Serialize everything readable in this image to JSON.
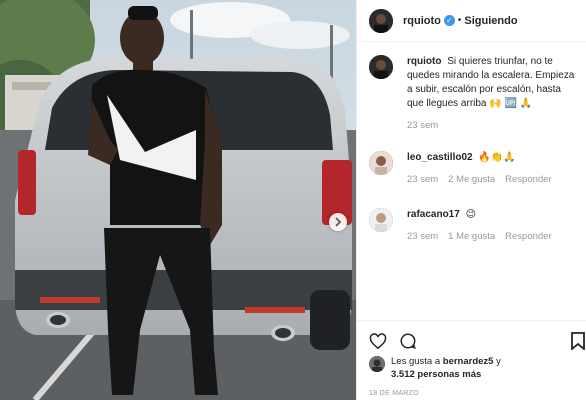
{
  "post": {
    "header": {
      "username": "rquioto",
      "verified_icon": "verified-badge-icon",
      "separator": "•",
      "follow_state": "Siguiendo"
    },
    "caption": {
      "username": "rquioto",
      "text": "Si quieres triunfar, no te quedes mirando la escalera. Empieza a subir, escalón por escalón, hasta que llegues arriba 🙌 🆙 🙏",
      "time": "23 sem"
    },
    "comments": [
      {
        "username": "leo_castillo02",
        "text": "🔥👏🙏",
        "time": "23 sem",
        "likes": "2 Me gusta",
        "reply": "Responder"
      },
      {
        "username": "rafacano17",
        "text": "😉",
        "time": "23 sem",
        "likes": "1 Me gusta",
        "reply": "Responder"
      }
    ],
    "likes": {
      "prefix": "Les gusta a",
      "user": "bernardez5",
      "connector": "y",
      "others": "3.512 personas más"
    },
    "date": "18 DE MARZO"
  },
  "icons": {
    "like": "heart-icon",
    "comment": "comment-icon",
    "bookmark": "bookmark-icon",
    "next": "chevron-right-icon"
  },
  "colors": {
    "verified": "#3897f0",
    "meta": "#999999",
    "text": "#262626"
  }
}
